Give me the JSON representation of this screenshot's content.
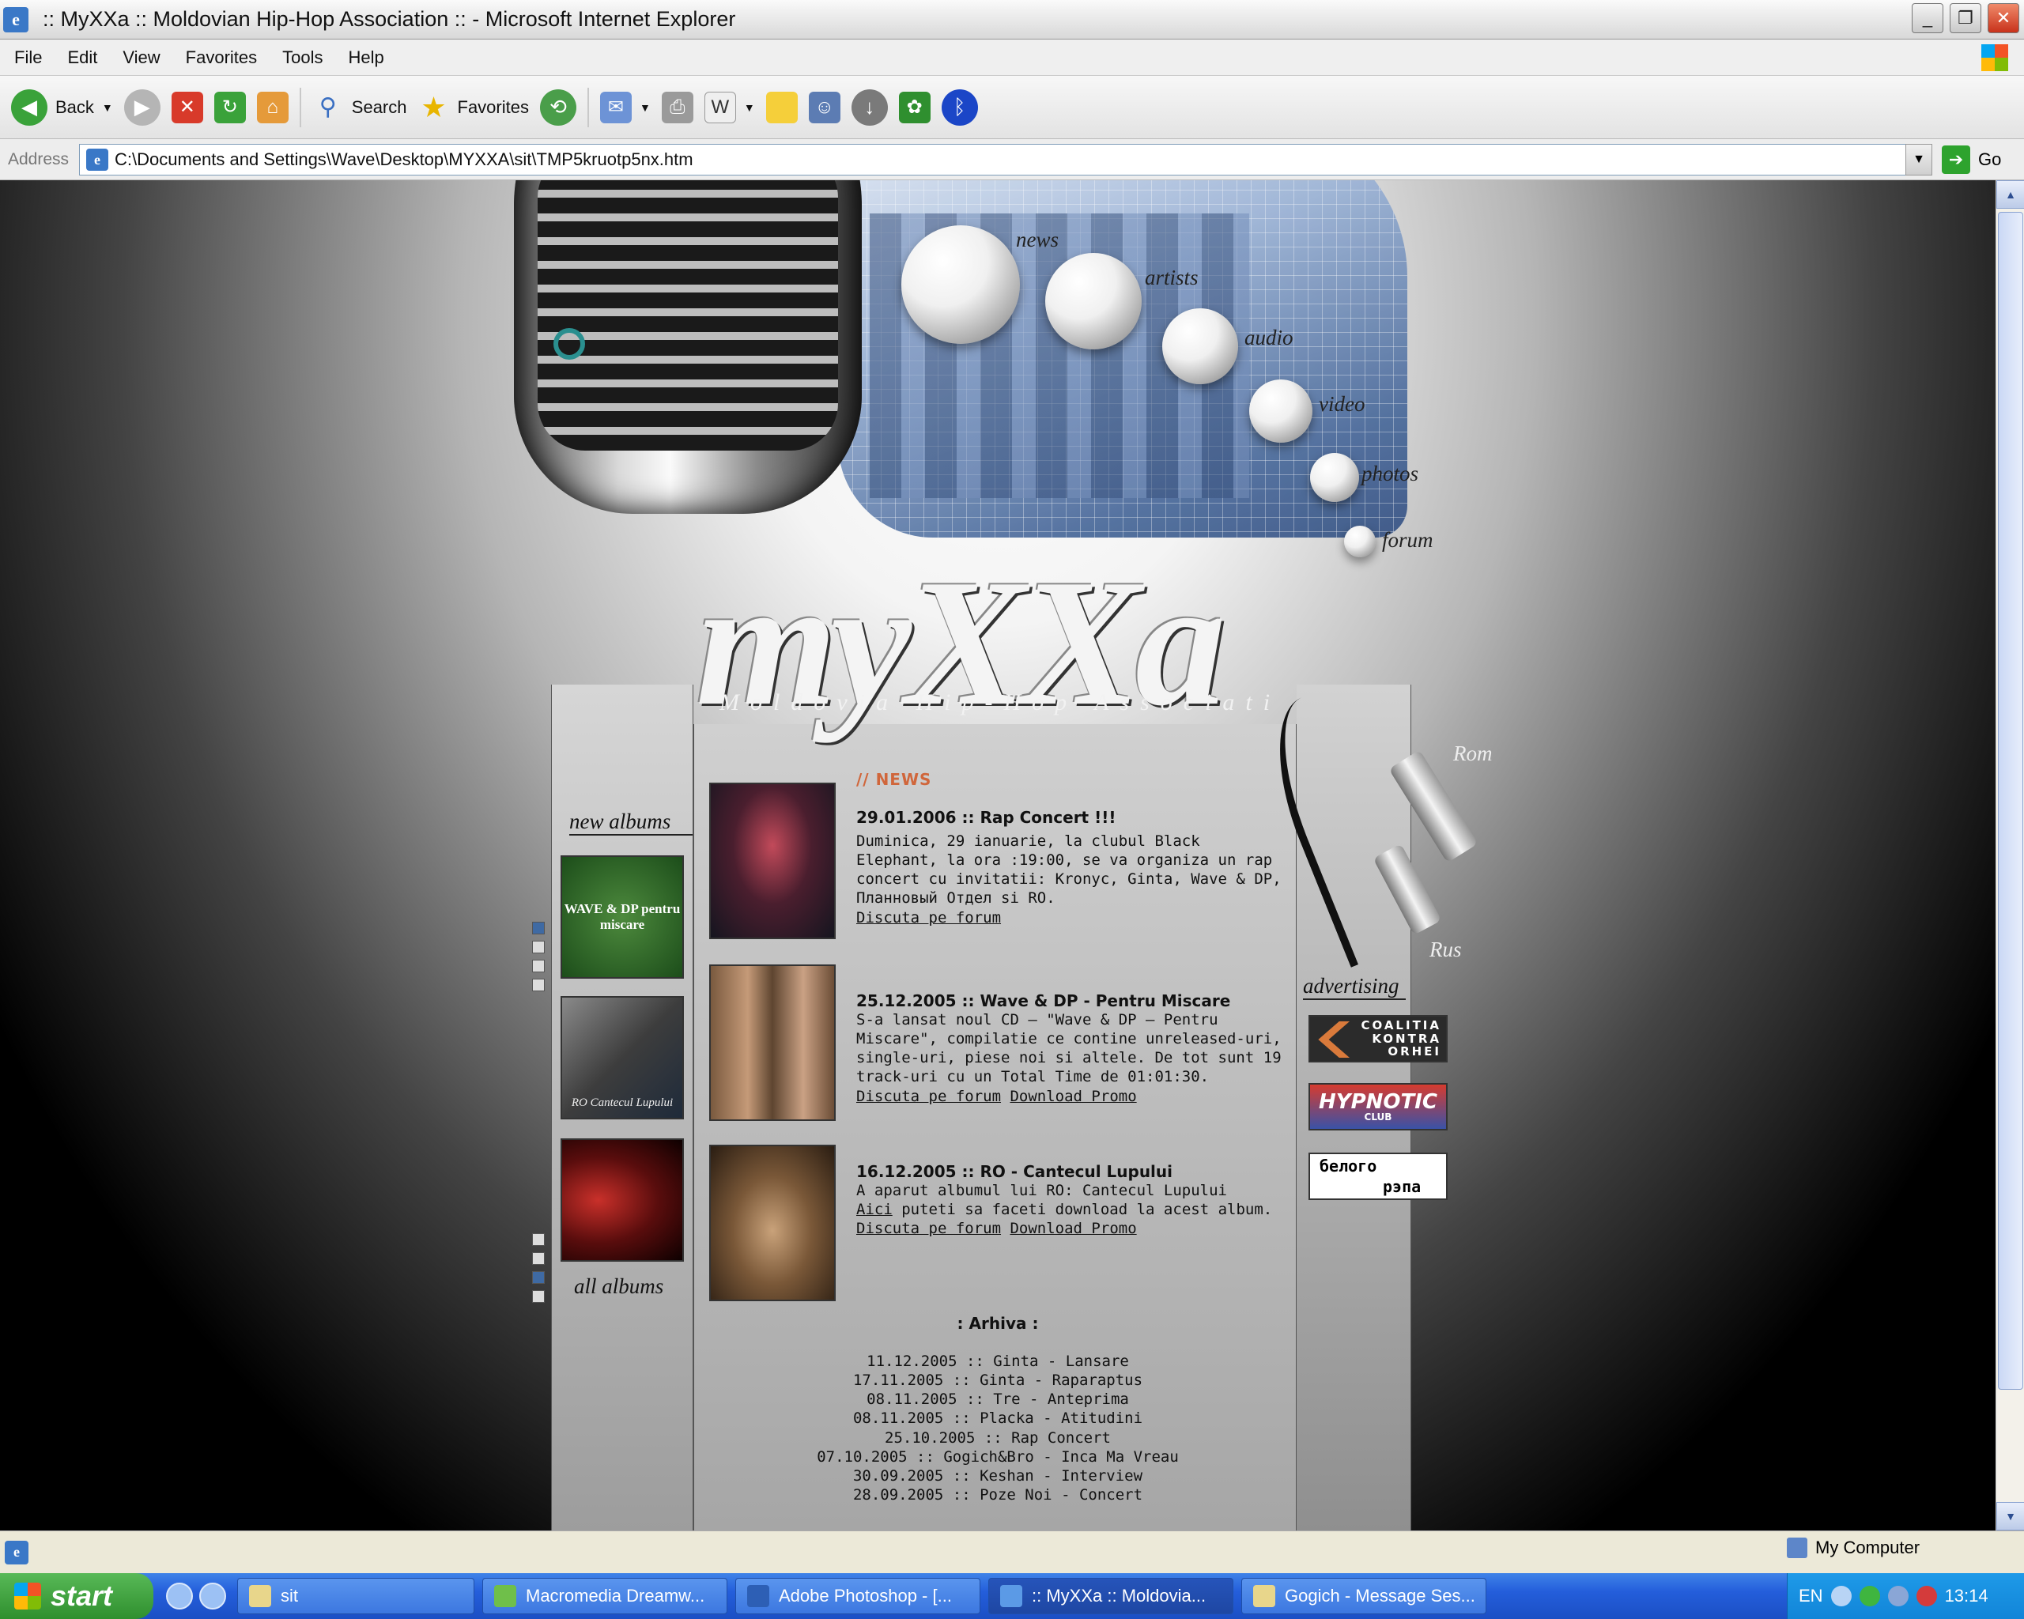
{
  "window": {
    "title": ":: MyXXa :: Moldovian Hip-Hop Association :: - Microsoft Internet Explorer"
  },
  "menu": [
    "File",
    "Edit",
    "View",
    "Favorites",
    "Tools",
    "Help"
  ],
  "toolbar": {
    "back": "Back",
    "search": "Search",
    "favorites": "Favorites"
  },
  "address": {
    "label": "Address",
    "url": "C:\\Documents and Settings\\Wave\\Desktop\\MYXXA\\sit\\TMP5kruotp5nx.htm",
    "go": "Go"
  },
  "site": {
    "logo": "myXXa",
    "subtitle": "Moldovia Hip-Hop Associati",
    "nav": [
      "news",
      "artists",
      "audio",
      "video",
      "photos",
      "forum"
    ],
    "lang": [
      "Rom",
      "Rus"
    ],
    "left": {
      "new_albums": "new albums",
      "all_albums": "all albums",
      "covers": [
        {
          "text": "WAVE & DP pentru miscare"
        },
        {
          "text": "RO Cantecul Lupului"
        },
        {
          "text": ""
        }
      ]
    },
    "right": {
      "advertising": "advertising",
      "ads": [
        {
          "l1": "COALITIA",
          "l2": "KONTRA",
          "l3": "ORHEI"
        },
        {
          "l1": "HYPNOTIC",
          "l2": "CLUB"
        },
        {
          "l1": "белого",
          "l2": "рэпа"
        }
      ]
    },
    "news_title": "// NEWS",
    "news": [
      {
        "head": "29.01.2006 :: Rap Concert !!!",
        "body": "Duminica, 29 ianuarie, la clubul Black Elephant, la ora :19:00, se va organiza un rap concert cu invitatii: Kronyc, Ginta, Wave & DP, Планновый Отдел si RO.",
        "link1": "Discuta pe forum",
        "link2": ""
      },
      {
        "head": "25.12.2005 :: Wave & DP - Pentru Miscare",
        "body": "S-a lansat noul CD – \"Wave & DP – Pentru Miscare\", compilatie ce contine unreleased-uri, single-uri, piese noi si altele. De tot sunt 19 track-uri cu un Total Time de 01:01:30.",
        "link1": "Discuta pe forum",
        "link2": "Download Promo"
      },
      {
        "head": "16.12.2005 :: RO - Cantecul Lupului",
        "body": "A aparut albumul lui RO: Cantecul Lupului",
        "aici": "Aici",
        "body2": " puteti sa faceti download la acest album.",
        "link1": "Discuta pe forum",
        "link2": "Download Promo"
      }
    ],
    "arhiva_title": ": Arhiva :",
    "arhiva": [
      "11.12.2005 :: Ginta - Lansare",
      "17.11.2005 :: Ginta - Raparaptus",
      "08.11.2005 :: Tre - Anteprima",
      "08.11.2005 :: Placka - Atitudini",
      "25.10.2005 :: Rap Concert",
      "07.10.2005 :: Gogich&Bro - Inca Ma Vreau",
      "30.09.2005 :: Keshan - Interview",
      "28.09.2005 :: Poze Noi - Concert"
    ]
  },
  "status": {
    "zone": "My Computer"
  },
  "taskbar": {
    "start": "start",
    "tasks": [
      "sit",
      "Macromedia Dreamw...",
      "Adobe Photoshop - [...",
      ":: MyXXa :: Moldovia...",
      "Gogich - Message Ses..."
    ],
    "lang": "EN",
    "clock": "13:14"
  }
}
